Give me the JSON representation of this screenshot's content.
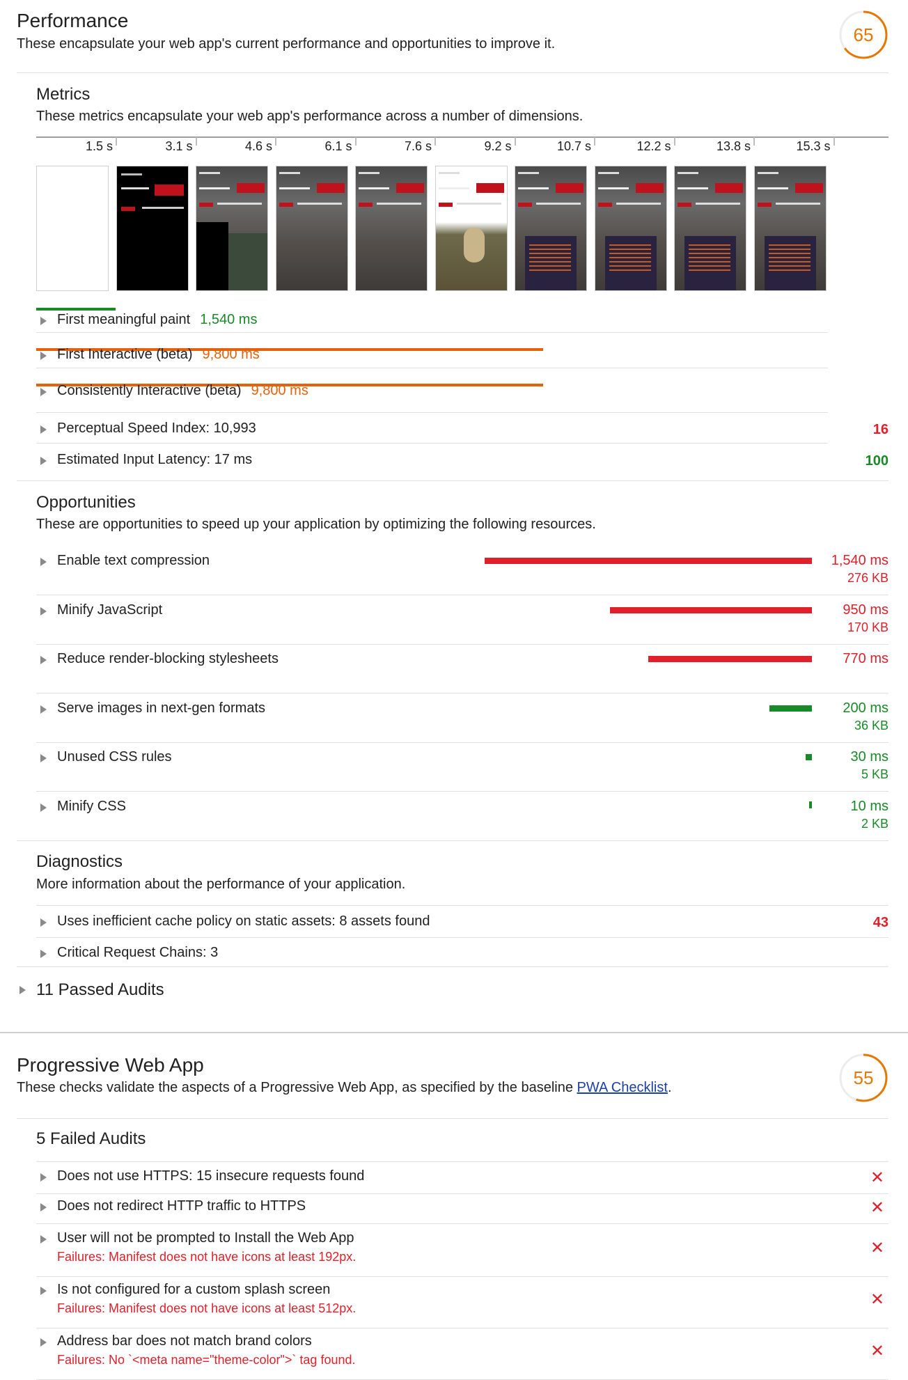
{
  "performance": {
    "title": "Performance",
    "description": "These encapsulate your web app's current performance and opportunities to improve it.",
    "score": "65",
    "score_color": "#e67700",
    "metrics": {
      "title": "Metrics",
      "description": "These metrics encapsulate your web app's performance across a number of dimensions.",
      "filmstrip_times": [
        "1.5 s",
        "3.1 s",
        "4.6 s",
        "6.1 s",
        "7.6 s",
        "9.2 s",
        "10.7 s",
        "12.2 s",
        "13.8 s",
        "15.3 s"
      ],
      "items": [
        {
          "label": "First meaningful paint",
          "value": "1,540 ms",
          "status": "green",
          "bar_fraction": 0.1
        },
        {
          "label": "First Interactive (beta)",
          "value": "9,800 ms",
          "status": "orange",
          "bar_fraction": 0.64
        },
        {
          "label": "Consistently Interactive (beta)",
          "value": "9,800 ms",
          "status": "orange",
          "bar_fraction": 0.64
        },
        {
          "label": "Perceptual Speed Index: 10,993",
          "score": "16",
          "status": "red"
        },
        {
          "label": "Estimated Input Latency: 17 ms",
          "score": "100",
          "status": "green"
        }
      ]
    },
    "opportunities": {
      "title": "Opportunities",
      "description": "These are opportunities to speed up your application by optimizing the following resources.",
      "items": [
        {
          "label": "Enable text compression",
          "ms": "1,540 ms",
          "kb": "276 KB",
          "status": "red",
          "bar_fraction": 1.0
        },
        {
          "label": "Minify JavaScript",
          "ms": "950 ms",
          "kb": "170 KB",
          "status": "red",
          "bar_fraction": 0.617
        },
        {
          "label": "Reduce render-blocking stylesheets",
          "ms": "770 ms",
          "kb": "",
          "status": "red",
          "bar_fraction": 0.5
        },
        {
          "label": "Serve images in next-gen formats",
          "ms": "200 ms",
          "kb": "36 KB",
          "status": "green",
          "bar_fraction": 0.13
        },
        {
          "label": "Unused CSS rules",
          "ms": "30 ms",
          "kb": "5 KB",
          "status": "green",
          "bar_fraction": 0.02
        },
        {
          "label": "Minify CSS",
          "ms": "10 ms",
          "kb": "2 KB",
          "status": "green",
          "bar_fraction": 0.007
        }
      ]
    },
    "diagnostics": {
      "title": "Diagnostics",
      "description": "More information about the performance of your application.",
      "items": [
        {
          "label": "Uses inefficient cache policy on static assets: 8 assets found",
          "score": "43",
          "status": "red"
        },
        {
          "label": "Critical Request Chains: 3",
          "score": "",
          "status": ""
        }
      ]
    },
    "passed": "11 Passed Audits"
  },
  "pwa": {
    "title": "Progressive Web App",
    "description_prefix": "These checks validate the aspects of a Progressive Web App, as specified by the baseline ",
    "description_link": "PWA Checklist",
    "description_suffix": ".",
    "score": "55",
    "score_color": "#e67700",
    "failed_title": "5 Failed Audits",
    "failed": [
      {
        "label": "Does not use HTTPS: 15 insecure requests found",
        "detail": ""
      },
      {
        "label": "Does not redirect HTTP traffic to HTTPS",
        "detail": ""
      },
      {
        "label": "User will not be prompted to Install the Web App",
        "detail": "Failures: Manifest does not have icons at least 192px."
      },
      {
        "label": "Is not configured for a custom splash screen",
        "detail": "Failures: Manifest does not have icons at least 512px."
      },
      {
        "label": "Address bar does not match brand colors",
        "detail": "Failures: No `<meta name=\"theme-color\">` tag found."
      }
    ],
    "fail_icon": "close-icon"
  }
}
